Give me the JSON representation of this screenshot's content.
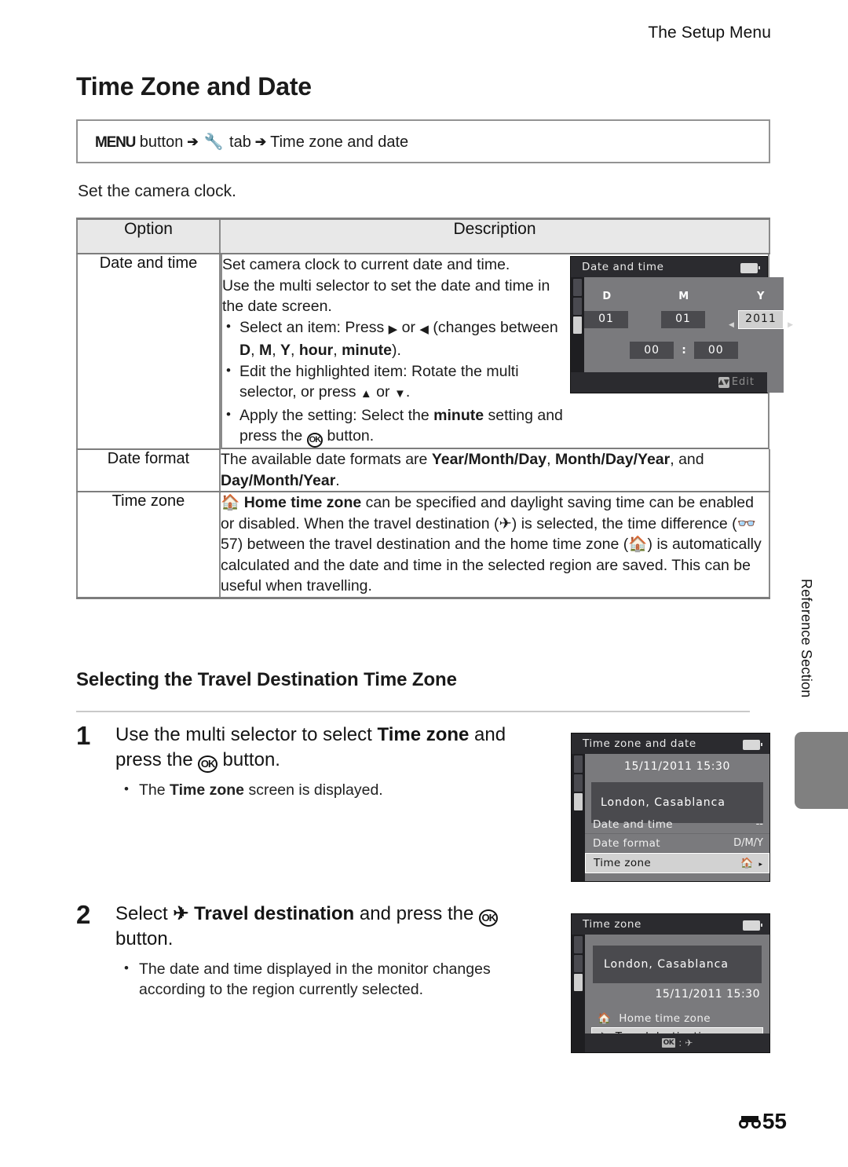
{
  "running_head": "The Setup Menu",
  "title": "Time Zone and Date",
  "menu_path": {
    "menu_label": "MENU",
    "button_word": "button",
    "arrow": "➔",
    "wrench_icon": "Ψ",
    "tab_word": "tab",
    "destination": "Time zone and date"
  },
  "lead_text": "Set the camera clock.",
  "table": {
    "headers": [
      "Option",
      "Description"
    ],
    "rows": [
      {
        "option": "Date and time",
        "desc_line1": "Set camera clock to current date and time.",
        "desc_line2": "Use the multi selector to set the date and time in the date screen.",
        "bullets": [
          "Select an item: Press ▶ or ◀ (changes between D, M, Y, hour, minute).",
          "Edit the highlighted item: Rotate the multi selector, or press ▲ or ▼.",
          "Apply the setting: Select the minute setting and press the OK button."
        ]
      },
      {
        "option": "Date format",
        "desc": "The available date formats are Year/Month/Day, Month/Day/Year, and Day/Month/Year."
      },
      {
        "option": "Time zone",
        "desc": "Home time zone can be specified and daylight saving time can be enabled or disabled. When the travel destination ( ) is selected, the time difference (57) between the travel destination and the home time zone ( ) is automatically calculated and the date and time in the selected region are saved. This can be useful when travelling."
      }
    ]
  },
  "screens": {
    "date_and_time": {
      "title": "Date and time",
      "labels": {
        "d": "D",
        "m": "M",
        "y": "Y"
      },
      "values": {
        "day": "01",
        "month": "01",
        "year": "2011",
        "hour": "00",
        "minute": "00"
      },
      "colon": ":",
      "footer_label": "Edit"
    },
    "time_zone_and_date": {
      "title": "Time zone and date",
      "datetime": "15/11/2011 15:30",
      "city": "London, Casablanca",
      "rows": [
        {
          "label": "Date and time",
          "value": "--",
          "selected": false
        },
        {
          "label": "Date format",
          "value": "D/M/Y",
          "selected": false
        },
        {
          "label": "Time zone",
          "value": "",
          "selected": true,
          "icon": "home-icon",
          "caret": "▸"
        }
      ]
    },
    "time_zone": {
      "title": "Time zone",
      "city": "London, Casablanca",
      "datetime": "15/11/2011 15:30",
      "rows": [
        {
          "icon": "home-icon",
          "label": "Home time zone",
          "selected": false
        },
        {
          "icon": "plane-icon",
          "label": "Travel destination",
          "selected": true
        }
      ],
      "footer_ok": "OK"
    }
  },
  "section_heading": "Selecting the Travel Destination Time Zone",
  "steps": [
    {
      "number": "1",
      "head_a": "Use the multi selector to select ",
      "head_b": "Time zone",
      "head_c": " and press the ",
      "head_d": " button.",
      "sub_a": "The ",
      "sub_b": "Time zone",
      "sub_c": " screen is displayed."
    },
    {
      "number": "2",
      "head_a": "Select ",
      "head_b": "Travel destination",
      "head_c": " and press the ",
      "head_d": " button.",
      "sub": "The date and time displayed in the monitor changes according to the region currently selected."
    }
  ],
  "side_tab_label": "Reference Section",
  "page_number": "55",
  "colors": {
    "table_header_bg": "#e8e8e8",
    "table_border": "#7d7d7d",
    "side_tab": "#808080",
    "lcd_bg": "#2b2b2f",
    "lcd_panel": "#7a7a7d",
    "lcd_highlight": "#d2d2d2"
  }
}
